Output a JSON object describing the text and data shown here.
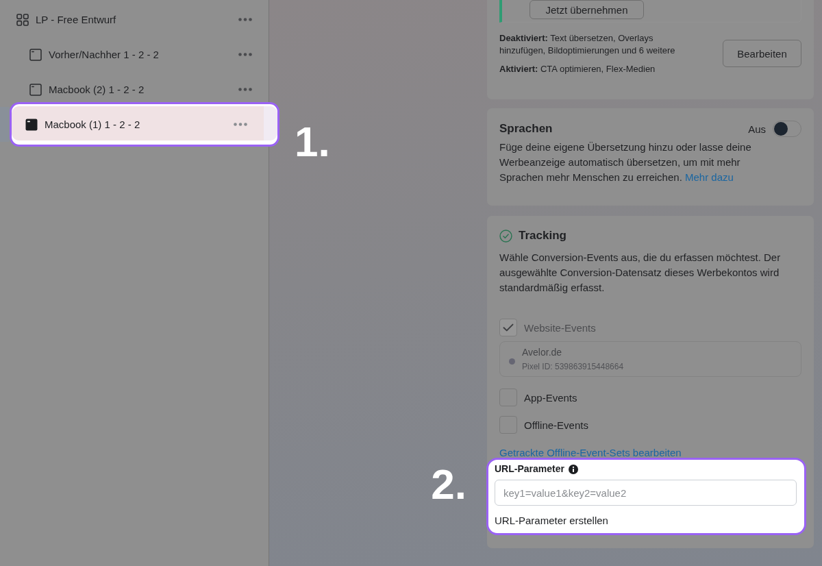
{
  "sidebar": {
    "items": [
      {
        "label": "LP - Free Entwurf",
        "kind": "campaign",
        "selected": false,
        "children": [
          {
            "label": "Vorher/Nachher 1 - 2 - 2",
            "kind": "ad",
            "selected": false
          },
          {
            "label": "Macbook (2) 1 - 2 - 2",
            "kind": "ad",
            "selected": false
          },
          {
            "label": "Macbook (1) 1 - 2 - 2",
            "kind": "ad",
            "selected": true,
            "callout": "1."
          }
        ]
      }
    ]
  },
  "creative_options": {
    "apply_button": "Jetzt übernehmen",
    "summary": [
      "**Deaktiviert:** Text übersetzen, Overlays hinzufügen, Bildoptimierungen und 6 weitere",
      "**Aktiviert:** CTA optimieren, Flex-Medien"
    ],
    "edit_button": "Bearbeiten"
  },
  "languages": {
    "title": "Sprachen",
    "toggle_label": "Aus",
    "on": false,
    "description": "Füge deine eigene Übersetzung hinzu oder lasse deine Werbeanzeige automatisch übersetzen, um mit mehr Sprachen mehr Menschen zu erreichen.",
    "link": "Mehr dazu"
  },
  "tracking": {
    "title": "Tracking",
    "description": "Wähle Conversion-Events aus, die du erfassen möchtest. Der ausgewählte Conversion-Datensatz dieses Werbekontos wird standardmäßig erfasst.",
    "events": [
      {
        "label": "Website-Events",
        "checked": true,
        "disabled": true,
        "pixel": {
          "name": "Avelor.de",
          "id": "Pixel ID: 539863915448664"
        }
      },
      {
        "label": "App-Events",
        "checked": false,
        "disabled": false
      },
      {
        "label": "Offline-Events",
        "checked": false,
        "disabled": false
      }
    ],
    "link": "Getrackte Offline-Event-Sets bearbeiten",
    "url_parameters": {
      "label": "URL-Parameter",
      "placeholder": "key1=value1&key2=value2",
      "create_link": "URL-Parameter erstellen",
      "callout": "2."
    }
  }
}
